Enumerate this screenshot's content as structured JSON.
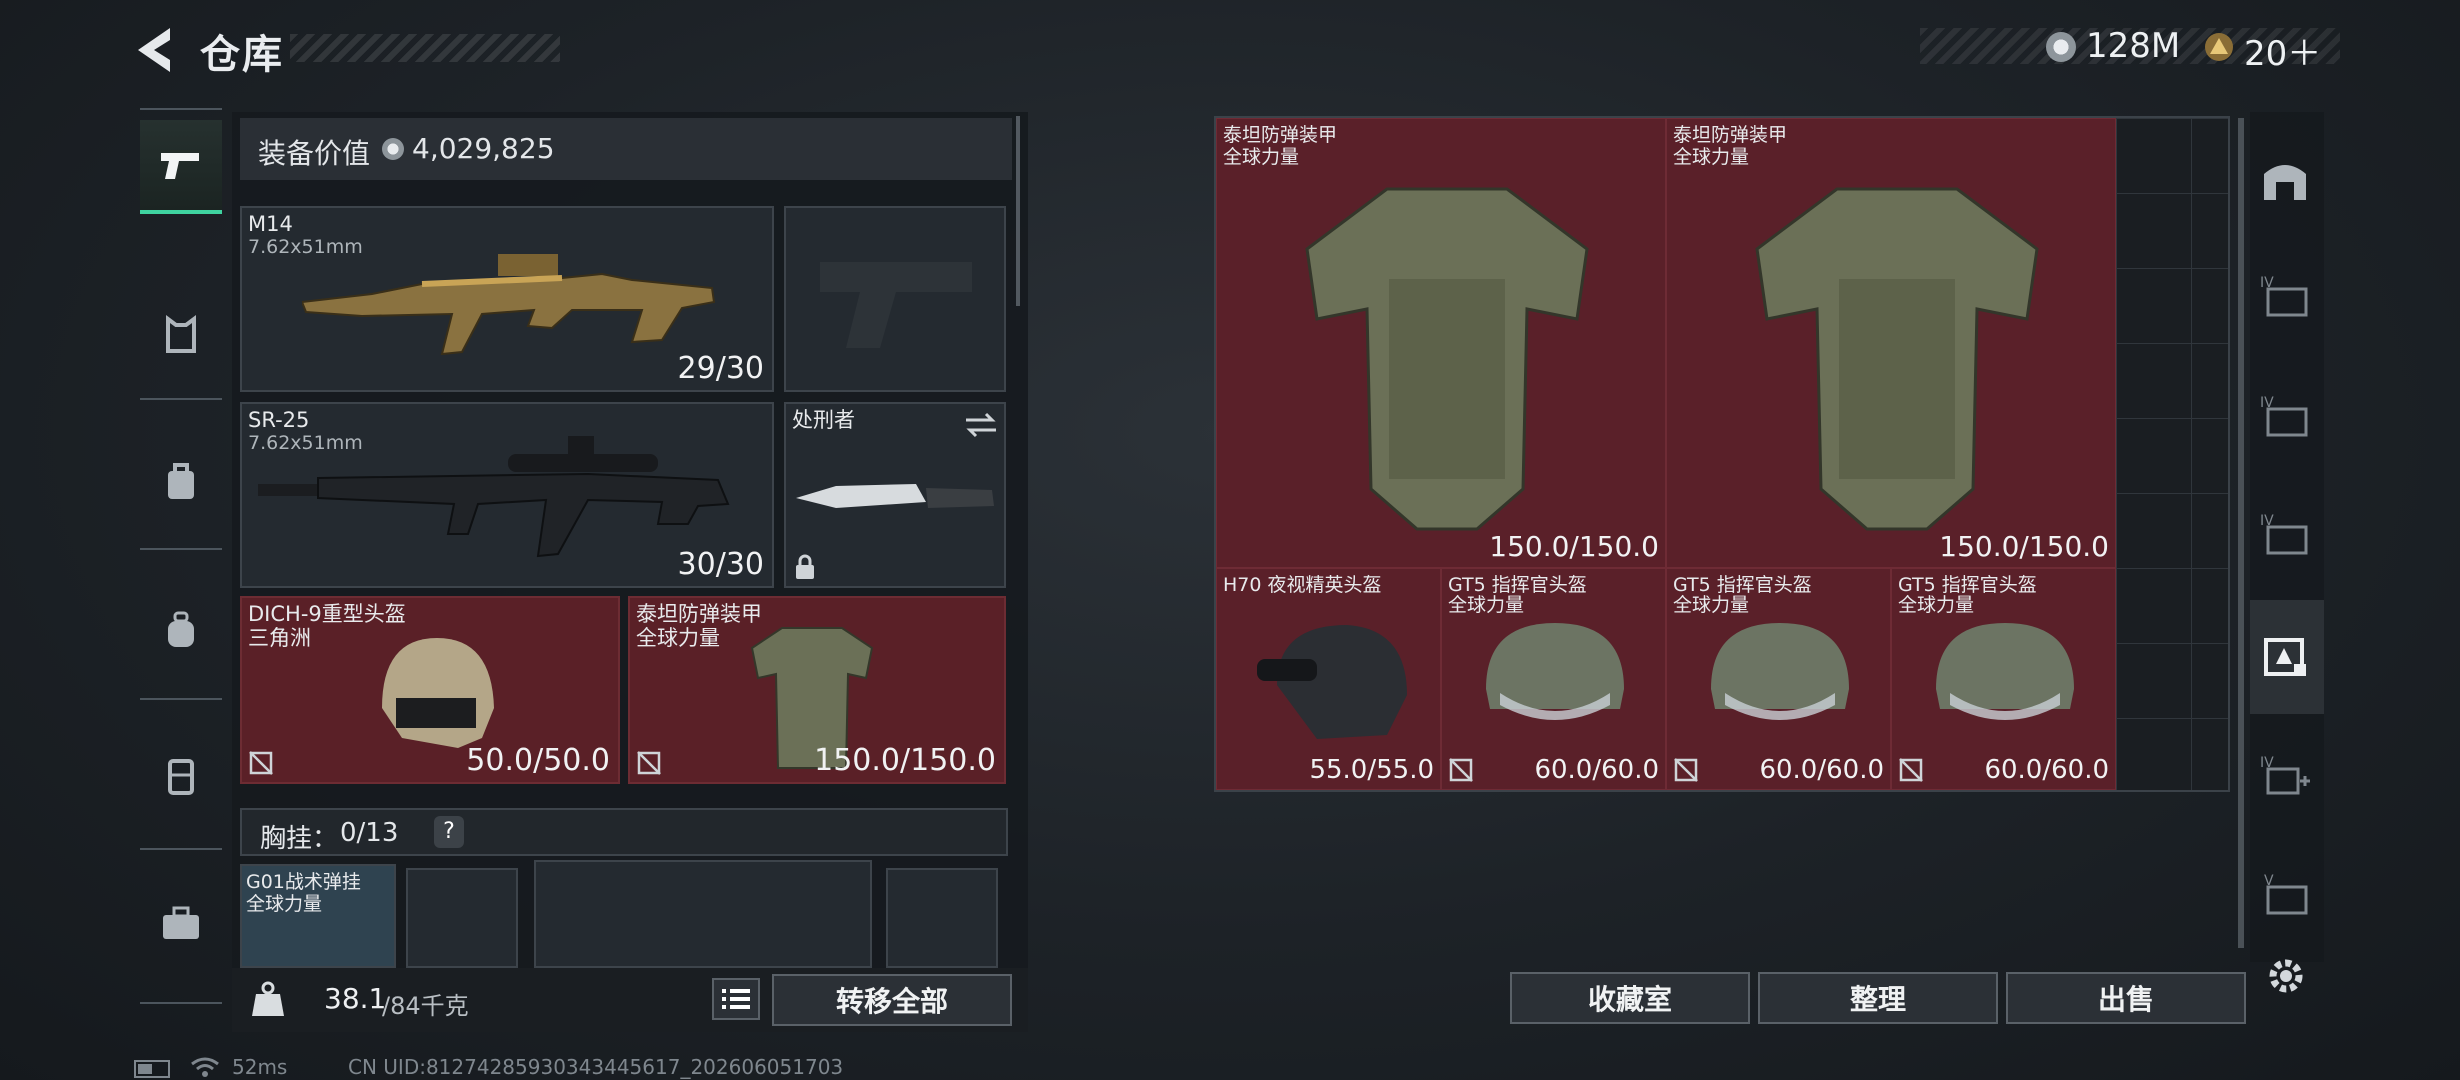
{
  "header": {
    "title": "仓库",
    "currency": [
      {
        "value": "128M",
        "icon": "silver-coin-icon",
        "color": "#c6ccd1"
      },
      {
        "value": "20＋",
        "icon": "gold-triangle-coin-icon",
        "color": "#c9a45a"
      }
    ]
  },
  "left_tabs": [
    "pistol-icon",
    "armor-icon",
    "rig-icon",
    "backpack-icon",
    "case-icon",
    "toolbox-icon"
  ],
  "loadout": {
    "equipment_value_label": "装备价值",
    "equipment_value": "4,029,825",
    "primary": {
      "name": "M14",
      "caliber": "7.62x51mm",
      "ammo": "29/30"
    },
    "secondary": {
      "name": "SR-25",
      "caliber": "7.62x51mm",
      "ammo": "30/30"
    },
    "melee": {
      "name": "处刑者"
    },
    "helmet": {
      "name": "DICH-9重型头盔",
      "sub": "三角洲",
      "durability": "50.0/50.0"
    },
    "armor": {
      "name": "泰坦防弹装甲",
      "sub": "全球力量",
      "durability": "150.0/150.0"
    },
    "chest_rig": {
      "label": "胸挂：",
      "capacity": "0/13",
      "help": "?"
    },
    "rig_item": {
      "name": "G01战术弹挂",
      "sub": "全球力量"
    },
    "weight": {
      "value": "38.1",
      "max": "/84千克"
    },
    "transfer_all": "转移全部"
  },
  "storage": {
    "items": [
      {
        "name": "泰坦防弹装甲",
        "sub": "全球力量",
        "value": "150.0/150.0"
      },
      {
        "name": "泰坦防弹装甲",
        "sub": "全球力量",
        "value": "150.0/150.0"
      },
      {
        "name": "H70 夜视精英头盔",
        "sub": "",
        "value": "55.0/55.0"
      },
      {
        "name": "GT5 指挥官头盔",
        "sub": "全球力量",
        "value": "60.0/60.0"
      },
      {
        "name": "GT5 指挥官头盔",
        "sub": "全球力量",
        "value": "60.0/60.0"
      },
      {
        "name": "GT5 指挥官头盔",
        "sub": "全球力量",
        "value": "60.0/60.0"
      }
    ],
    "buttons": {
      "collection": "收藏室",
      "sort": "整理",
      "sell": "出售"
    }
  },
  "right_tabs": [
    "home-vault-icon",
    "container-iv-icon",
    "container-iv-icon",
    "container-iv-icon",
    "selected-container-icon",
    "container-add-icon",
    "container-v-icon"
  ],
  "footer": {
    "ping": "52ms",
    "uid": "CN UID:81274285930343445617_202606051703"
  }
}
